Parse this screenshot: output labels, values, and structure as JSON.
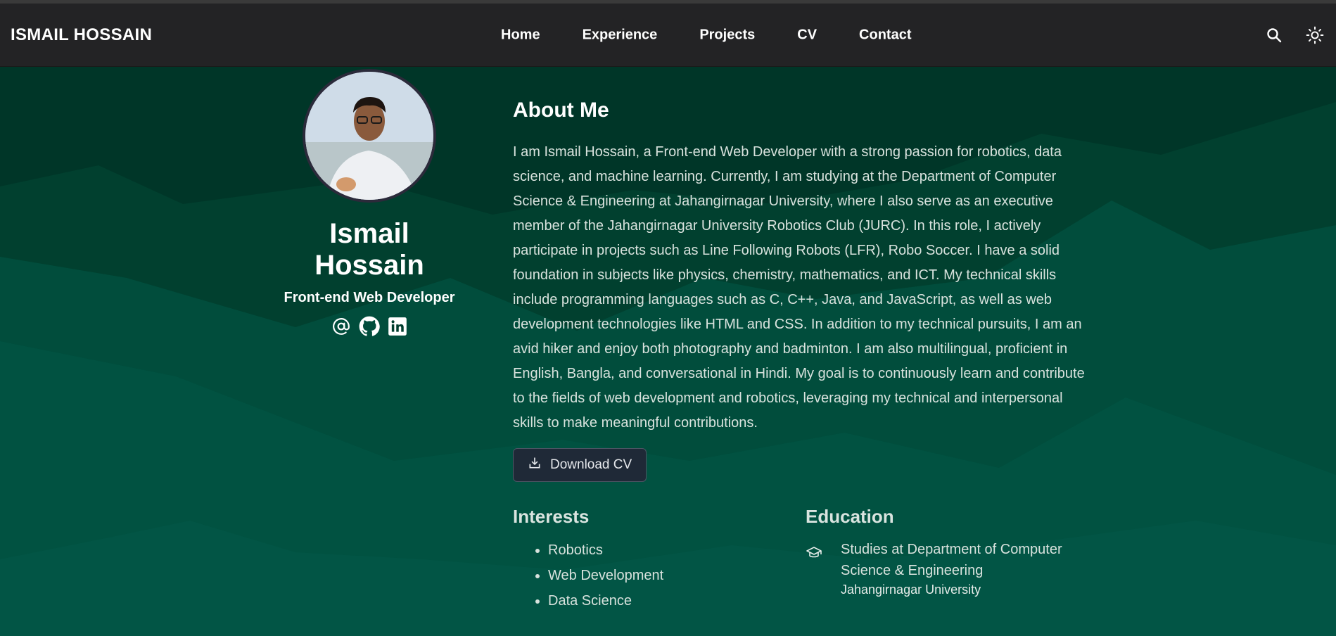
{
  "navbar": {
    "brand": "ISMAIL HOSSAIN",
    "links": [
      "Home",
      "Experience",
      "Projects",
      "CV",
      "Contact"
    ],
    "icons": [
      "search-icon",
      "sun-icon"
    ]
  },
  "profile": {
    "name": "Ismail Hossain",
    "role": "Front-end Web Developer",
    "socials": [
      "at-sign-icon",
      "github-icon",
      "linkedin-icon"
    ]
  },
  "about": {
    "title": "About Me",
    "text": "I am Ismail Hossain, a Front-end Web Developer with a strong passion for robotics, data science, and machine learning. Currently, I am studying at the Department of Computer Science & Engineering at Jahangirnagar University, where I also serve as an executive member of the Jahangirnagar University Robotics Club (JURC). In this role, I actively participate in projects such as Line Following Robots (LFR), Robo Soccer. I have a solid foundation in subjects like physics, chemistry, mathematics, and ICT. My technical skills include programming languages such as C, C++, Java, and JavaScript, as well as web development technologies like HTML and CSS. In addition to my technical pursuits, I am an avid hiker and enjoy both photography and badminton. I am also multilingual, proficient in English, Bangla, and conversational in Hindi. My goal is to continuously learn and contribute to the fields of web development and robotics, leveraging my technical and interpersonal skills to make meaningful contributions.",
    "download_label": "Download CV"
  },
  "interests": {
    "title": "Interests",
    "items": [
      "Robotics",
      "Web Development",
      "Data Science"
    ]
  },
  "education": {
    "title": "Education",
    "items": [
      {
        "degree": "Studies at Department of Computer Science & Engineering",
        "institution": "Jahangirnagar University"
      }
    ]
  },
  "colors": {
    "navbar_bg": "#232325",
    "page_bg_dark": "#003628",
    "mountain_mid": "#014d3c",
    "mountain_light": "#025545",
    "button_bg": "#1f2937"
  }
}
